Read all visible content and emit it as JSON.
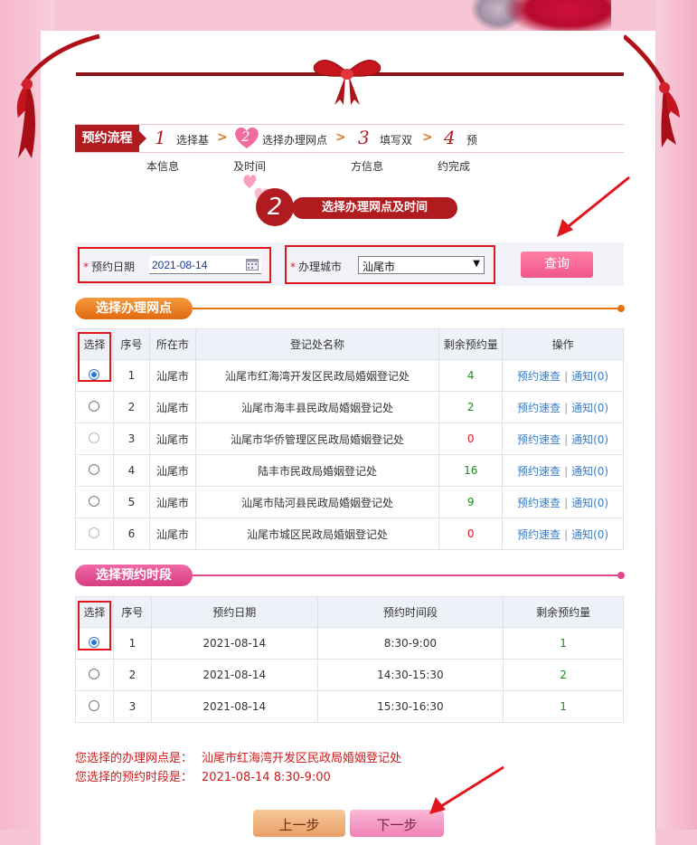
{
  "steps": {
    "label": "预约流程",
    "items": [
      {
        "num": "1",
        "line1": "选择基",
        "line2": "本信息"
      },
      {
        "num": "2",
        "line1": "选择办理网点",
        "line2": "及时间"
      },
      {
        "num": "3",
        "line1": "填写双",
        "line2": "方信息"
      },
      {
        "num": "4",
        "line1": "预",
        "line2": "约完成"
      }
    ]
  },
  "banner": {
    "num": "2",
    "title": "选择办理网点及时间"
  },
  "search": {
    "date_label": "预约日期",
    "date_value": "2021-08-14",
    "city_label": "办理城市",
    "city_value": "汕尾市",
    "query_label": "查询"
  },
  "offices": {
    "section_title": "选择办理网点",
    "headers": [
      "选择",
      "序号",
      "所在市",
      "登记处名称",
      "剩余预约量",
      "操作"
    ],
    "rows": [
      {
        "idx": "1",
        "city": "汕尾市",
        "name": "汕尾市红海湾开发区民政局婚姻登记处",
        "remaining": "4",
        "op1": "预约速查",
        "op2": "通知(0)"
      },
      {
        "idx": "2",
        "city": "汕尾市",
        "name": "汕尾市海丰县民政局婚姻登记处",
        "remaining": "2",
        "op1": "预约速查",
        "op2": "通知(0)"
      },
      {
        "idx": "3",
        "city": "汕尾市",
        "name": "汕尾市华侨管理区民政局婚姻登记处",
        "remaining": "0",
        "op1": "预约速查",
        "op2": "通知(0)"
      },
      {
        "idx": "4",
        "city": "汕尾市",
        "name": "陆丰市民政局婚姻登记处",
        "remaining": "16",
        "op1": "预约速查",
        "op2": "通知(0)"
      },
      {
        "idx": "5",
        "city": "汕尾市",
        "name": "汕尾市陆河县民政局婚姻登记处",
        "remaining": "9",
        "op1": "预约速查",
        "op2": "通知(0)"
      },
      {
        "idx": "6",
        "city": "汕尾市",
        "name": "汕尾市城区民政局婚姻登记处",
        "remaining": "0",
        "op1": "预约速查",
        "op2": "通知(0)"
      }
    ]
  },
  "slots": {
    "section_title": "选择预约时段",
    "headers": [
      "选择",
      "序号",
      "预约日期",
      "预约时间段",
      "剩余预约量"
    ],
    "rows": [
      {
        "idx": "1",
        "date": "2021-08-14",
        "time": "8:30-9:00",
        "remaining": "1"
      },
      {
        "idx": "2",
        "date": "2021-08-14",
        "time": "14:30-15:30",
        "remaining": "2"
      },
      {
        "idx": "3",
        "date": "2021-08-14",
        "time": "15:30-16:30",
        "remaining": "1"
      }
    ]
  },
  "summary": {
    "office_label": "您选择的办理网点是：",
    "office_value": "汕尾市红海湾开发区民政局婚姻登记处",
    "slot_label": "您选择的预约时段是：",
    "slot_value": "2021-08-14 8:30-9:00"
  },
  "nav": {
    "prev": "上一步",
    "next": "下一步"
  },
  "colors": {
    "primary_red": "#b01b1f",
    "orange": "#e8720c",
    "pink": "#e0488a",
    "link_blue": "#3b7dc6"
  }
}
